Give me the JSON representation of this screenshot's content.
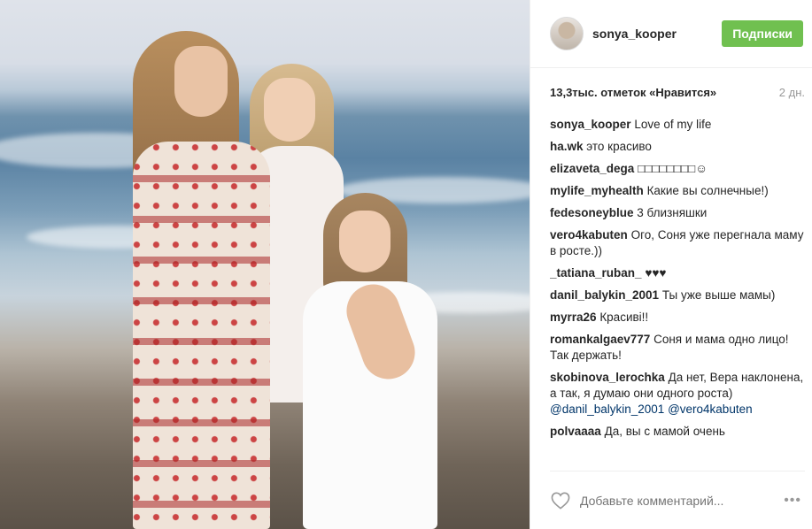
{
  "post": {
    "image_alt": "Three people posing on a beach",
    "header": {
      "username": "sonya_kooper",
      "follow_label": "Подписки",
      "follow_color": "#70c050"
    },
    "likes_text": "13,3тыс. отметок «Нравится»",
    "date_text": "2 дн.",
    "comments": [
      {
        "user": "sonya_kooper",
        "text": "Love of my life"
      },
      {
        "user": "ha.wk",
        "text": "это красиво"
      },
      {
        "user": "elizaveta_dega",
        "text": "□□□□□□□□☺"
      },
      {
        "user": "mylife_myhealth",
        "text": "Какие вы солнечные!)"
      },
      {
        "user": "fedesoneyblue",
        "text": "3 близняшки"
      },
      {
        "user": "vero4kabuten",
        "text": "Ого, Соня уже перегнала маму в росте.))"
      },
      {
        "user": "_tatiana_ruban_",
        "text": "♥♥♥"
      },
      {
        "user": "danil_balykin_2001",
        "text": "Ты уже выше мамы)"
      },
      {
        "user": "myrra26",
        "text": "Красиві!!"
      },
      {
        "user": "romankalgaev777",
        "text": "Соня и мама одно лицо! Так держать!"
      },
      {
        "user": "skobinova_lerochka",
        "text": "Да нет, Вера наклонена, а так, я думаю они одного роста)",
        "mentions": [
          "@danil_balykin_2001",
          "@vero4kabuten"
        ]
      },
      {
        "user": "polvaaaa",
        "text": "Да, вы с мамой очень"
      }
    ],
    "footer": {
      "comment_placeholder": "Добавьте комментарий...",
      "more_label": "•••",
      "heart_icon": "heart-outline-icon"
    }
  }
}
